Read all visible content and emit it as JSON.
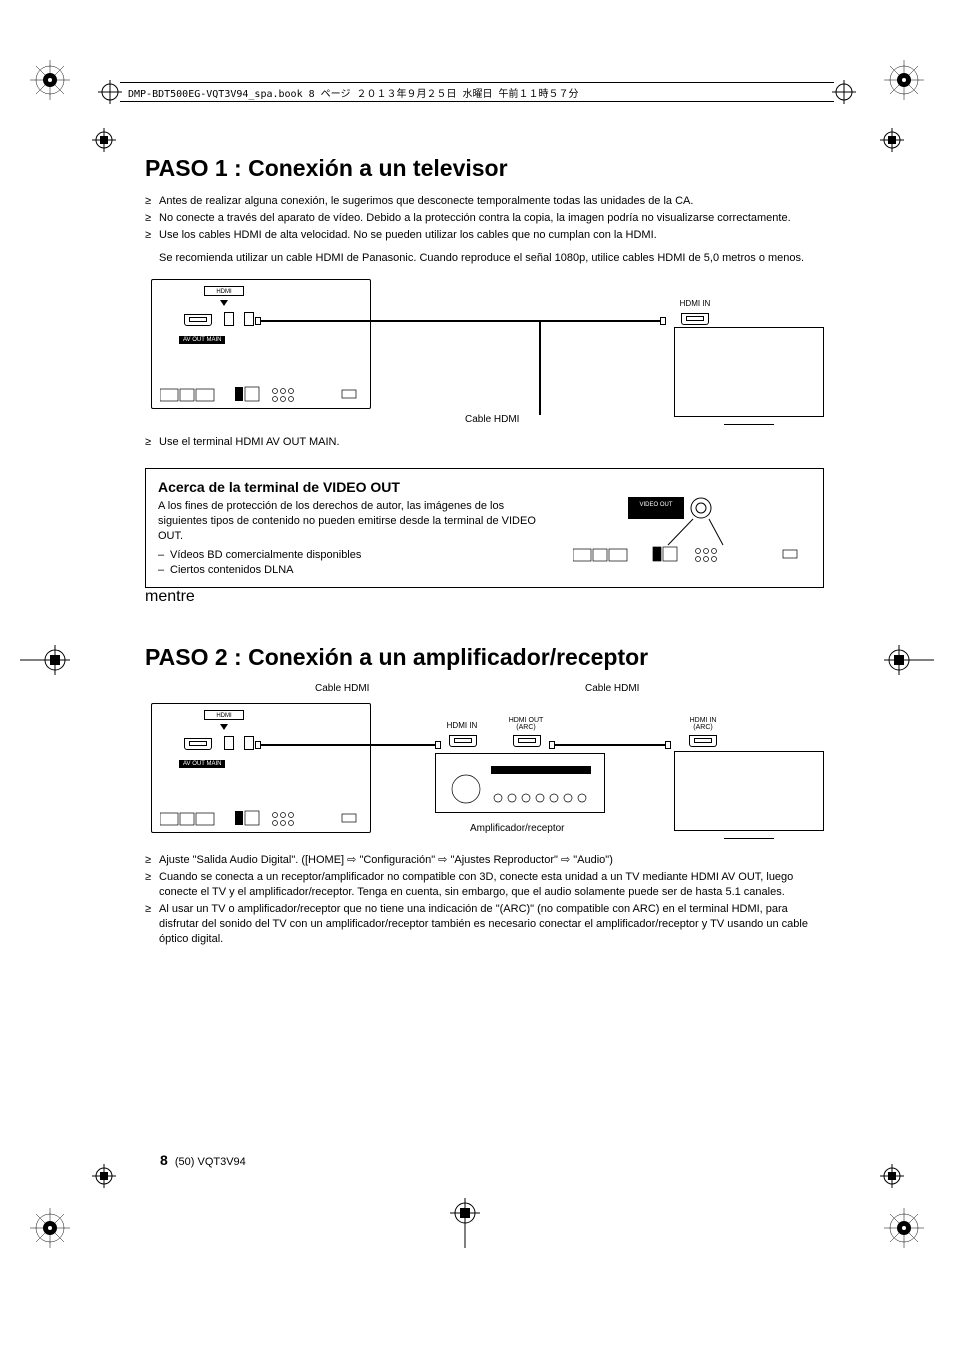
{
  "header": {
    "runner": "DMP-BDT500EG-VQT3V94_spa.book  8 ページ  ２０１３年９月２５日  水曜日  午前１１時５７分"
  },
  "step1": {
    "heading": "PASO 1 :  Conexión a un televisor",
    "bullets": [
      "Antes de realizar alguna conexión, le sugerimos que desconecte temporalmente todas las unidades de la CA.",
      "No conecte a través del aparato de vídeo. Debido a la protección contra la copia, la imagen podría no visualizarse correctamente.",
      "Use los cables HDMI de alta velocidad. No se pueden utilizar los cables que no cumplan con la HDMI."
    ],
    "sub": "Se recomienda utilizar un cable HDMI de Panasonic. Cuando reproduce el señal 1080p, utilice cables HDMI de 5,0 metros o menos.",
    "diagram": {
      "av_out_label": "AV OUT   MAIN",
      "hdmi_in_label": "HDMI IN",
      "cable_label": "Cable HDMI"
    },
    "post_bullet": "Use el terminal HDMI AV OUT MAIN."
  },
  "infobox": {
    "heading": "Acerca de la terminal de VIDEO OUT",
    "body": "A los fines de protección de los derechos de autor, las imágenes de los siguientes tipos de contenido no pueden emitirse desde la terminal de VIDEO OUT.",
    "items": [
      "Vídeos BD comercialmente disponibles",
      "Ciertos contenidos DLNA"
    ],
    "video_out_label": "VIDEO OUT"
  },
  "step2": {
    "heading": "PASO 2 :  Conexión a un amplificador/receptor",
    "diagram": {
      "cable_label_left": "Cable HDMI",
      "cable_label_right": "Cable HDMI",
      "av_out_label": "AV OUT   MAIN",
      "hdmi_in_label": "HDMI IN",
      "hdmi_out_arc_label": "HDMI OUT\n(ARC)",
      "hdmi_in_arc_label": "HDMI IN\n(ARC)",
      "amp_label": "Amplificador/receptor"
    },
    "bullets": [
      "Ajuste \"Salida Audio Digital\". ([HOME] ⇨ \"Configuración\" ⇨ \"Ajustes Reproductor\" ⇨ \"Audio\")",
      "Cuando se conecta a un receptor/amplificador no compatible con 3D, conecte esta unidad a un TV mediante HDMI AV OUT, luego conecte el TV y el amplificador/receptor. Tenga en cuenta, sin embargo, que el audio solamente puede ser de hasta 5.1 canales.",
      "Al usar un TV o amplificador/receptor que no tiene una indicación de \"(ARC)\" (no compatible con ARC) en el terminal HDMI, para disfrutar del sonido del TV con un amplificador/receptor también es necesario conectar el amplificador/receptor y TV usando un cable óptico digital."
    ]
  },
  "footer": {
    "page": "8",
    "meta": "(50)  VQT3V94"
  }
}
